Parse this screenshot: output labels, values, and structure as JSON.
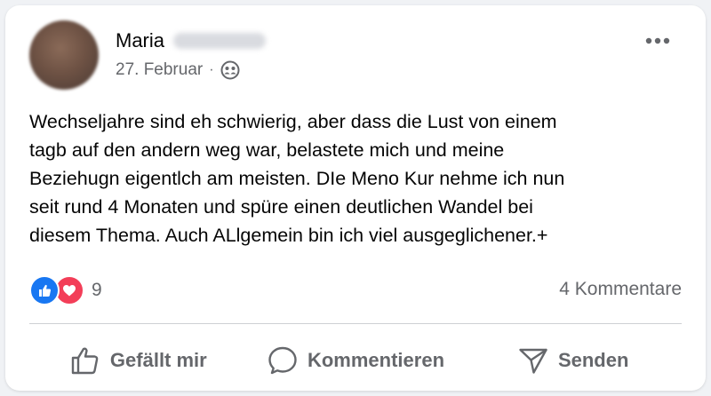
{
  "post": {
    "author_first_name": "Maria",
    "date": "27. Februar",
    "separator": "·",
    "audience_icon": "friends-icon",
    "more_icon": "more-options-icon",
    "text": "Wechseljahre sind eh schwierig, aber dass die Lust von einem\ntagb auf den andern weg war, belastete mich und meine\nBeziehugn eigentlch am meisten. DIe Meno Kur nehme ich nun\nseit rund 4 Monaten und spüre einen deutlichen Wandel bei\ndiesem Thema. Auch ALlgemein bin ich viel ausgeglichener.+"
  },
  "reactions": {
    "icons": [
      "like-icon",
      "love-icon"
    ],
    "count": "9",
    "comments_label": "4 Kommentare"
  },
  "actions": {
    "like_label": "Gefällt mir",
    "comment_label": "Kommentieren",
    "share_label": "Senden"
  },
  "colors": {
    "like_blue": "#1877f2",
    "love_red": "#f33e58",
    "secondary_text": "#65676b",
    "divider": "#ced0d4"
  }
}
